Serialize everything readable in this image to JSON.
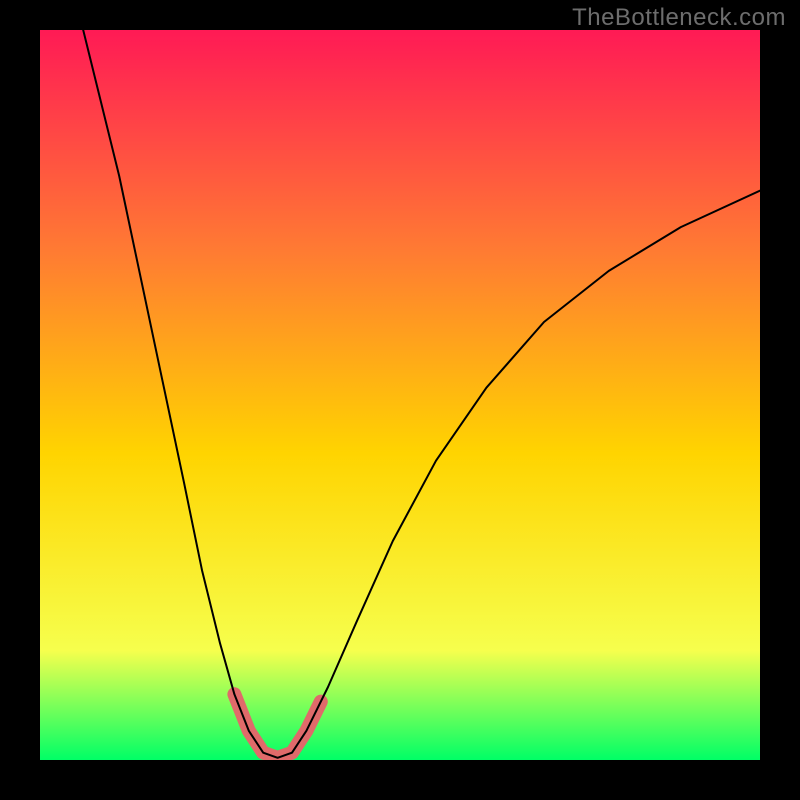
{
  "watermark": "TheBottleneck.com",
  "chart_data": {
    "type": "line",
    "title": "",
    "xlabel": "",
    "ylabel": "",
    "xlim": [
      0,
      100
    ],
    "ylim": [
      0,
      100
    ],
    "background_gradient": {
      "top": "#ff1a55",
      "mid1": "#ff7a33",
      "mid2": "#ffd400",
      "mid3": "#f6ff4d",
      "bottom": "#00ff66"
    },
    "series": [
      {
        "name": "bottleneck-curve",
        "stroke": "#000000",
        "stroke_width": 2,
        "points": [
          {
            "x": 6.0,
            "y": 100.0
          },
          {
            "x": 8.0,
            "y": 92.0
          },
          {
            "x": 11.0,
            "y": 80.0
          },
          {
            "x": 14.0,
            "y": 66.0
          },
          {
            "x": 17.0,
            "y": 52.0
          },
          {
            "x": 20.0,
            "y": 38.0
          },
          {
            "x": 22.5,
            "y": 26.0
          },
          {
            "x": 25.0,
            "y": 16.0
          },
          {
            "x": 27.0,
            "y": 9.0
          },
          {
            "x": 29.0,
            "y": 4.0
          },
          {
            "x": 31.0,
            "y": 1.0
          },
          {
            "x": 33.0,
            "y": 0.3
          },
          {
            "x": 35.0,
            "y": 1.0
          },
          {
            "x": 37.0,
            "y": 4.0
          },
          {
            "x": 40.0,
            "y": 10.0
          },
          {
            "x": 44.0,
            "y": 19.0
          },
          {
            "x": 49.0,
            "y": 30.0
          },
          {
            "x": 55.0,
            "y": 41.0
          },
          {
            "x": 62.0,
            "y": 51.0
          },
          {
            "x": 70.0,
            "y": 60.0
          },
          {
            "x": 79.0,
            "y": 67.0
          },
          {
            "x": 89.0,
            "y": 73.0
          },
          {
            "x": 100.0,
            "y": 78.0
          }
        ]
      },
      {
        "name": "optimal-range-marker",
        "stroke": "#e06a6a",
        "stroke_width": 14,
        "points": [
          {
            "x": 27.0,
            "y": 9.0
          },
          {
            "x": 29.0,
            "y": 4.0
          },
          {
            "x": 31.0,
            "y": 1.0
          },
          {
            "x": 33.0,
            "y": 0.3
          },
          {
            "x": 35.0,
            "y": 1.0
          },
          {
            "x": 37.0,
            "y": 4.0
          },
          {
            "x": 39.0,
            "y": 8.0
          }
        ]
      }
    ]
  }
}
